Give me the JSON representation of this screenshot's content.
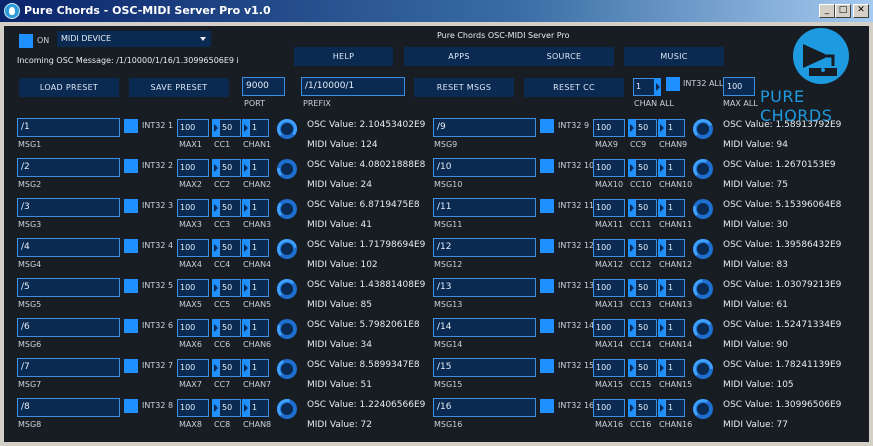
{
  "window": {
    "title": "Pure Chords - OSC-MIDI Server Pro v1.0",
    "minimize_glyph": "_",
    "maximize_glyph": "□",
    "close_glyph": "✕"
  },
  "header": {
    "on_label": "ON",
    "device_selected": "MIDI DEVICE",
    "app_title": "Pure Chords OSC-MIDI Server Pro",
    "incoming_label": "Incoming OSC Message: /1/10000/1/16/1.30996506E9 i",
    "nav_buttons": [
      "HELP",
      "APPS",
      "SOURCE",
      "MUSIC"
    ],
    "load_preset": "LOAD PRESET",
    "save_preset": "SAVE PRESET",
    "port_value": "9000",
    "port_label": "PORT",
    "prefix_value": "/1/10000/1",
    "prefix_label": "PREFIX",
    "reset_msgs": "RESET MSGS",
    "reset_cc": "RESET CC",
    "chan_all_value": "1",
    "chan_all_label": "CHAN ALL",
    "int32_all_label": "INT32 ALL",
    "max_all_value": "100",
    "max_all_label": "MAX ALL"
  },
  "logo": {
    "text": "PURE CHORDS",
    "icon": "gramophone-icon",
    "color": "#1e9be0"
  },
  "accent_color": "#1e90ff",
  "channels": [
    {
      "msg": "/1",
      "msg_label": "MSG1",
      "int32": "INT32 1",
      "max": "100",
      "max_label": "MAX1",
      "cc": "50",
      "cc_label": "CC1",
      "chan": "1",
      "chan_label": "CHAN1",
      "osc": "OSC Value: 2.10453402E9",
      "midi": "MIDI Value: 124",
      "knob": 0.98
    },
    {
      "msg": "/2",
      "msg_label": "MSG2",
      "int32": "INT32 2",
      "max": "100",
      "max_label": "MAX2",
      "cc": "50",
      "cc_label": "CC2",
      "chan": "1",
      "chan_label": "CHAN2",
      "osc": "OSC Value: 4.08021888E8",
      "midi": "MIDI Value: 24",
      "knob": 0.19
    },
    {
      "msg": "/3",
      "msg_label": "MSG3",
      "int32": "INT32 3",
      "max": "100",
      "max_label": "MAX3",
      "cc": "50",
      "cc_label": "CC3",
      "chan": "1",
      "chan_label": "CHAN3",
      "osc": "OSC Value: 6.8719475E8",
      "midi": "MIDI Value: 41",
      "knob": 0.32
    },
    {
      "msg": "/4",
      "msg_label": "MSG4",
      "int32": "INT32 4",
      "max": "100",
      "max_label": "MAX4",
      "cc": "50",
      "cc_label": "CC4",
      "chan": "1",
      "chan_label": "CHAN4",
      "osc": "OSC Value: 1.71798694E9",
      "midi": "MIDI Value: 102",
      "knob": 0.8
    },
    {
      "msg": "/5",
      "msg_label": "MSG5",
      "int32": "INT32 5",
      "max": "100",
      "max_label": "MAX5",
      "cc": "50",
      "cc_label": "CC5",
      "chan": "1",
      "chan_label": "CHAN5",
      "osc": "OSC Value: 1.43881408E9",
      "midi": "MIDI Value: 85",
      "knob": 0.67
    },
    {
      "msg": "/6",
      "msg_label": "MSG6",
      "int32": "INT32 6",
      "max": "100",
      "max_label": "MAX6",
      "cc": "50",
      "cc_label": "CC6",
      "chan": "1",
      "chan_label": "CHAN6",
      "osc": "OSC Value: 5.7982061E8",
      "midi": "MIDI Value: 34",
      "knob": 0.27
    },
    {
      "msg": "/7",
      "msg_label": "MSG7",
      "int32": "INT32 7",
      "max": "100",
      "max_label": "MAX7",
      "cc": "50",
      "cc_label": "CC7",
      "chan": "1",
      "chan_label": "CHAN7",
      "osc": "OSC Value: 8.5899347E8",
      "midi": "MIDI Value: 51",
      "knob": 0.4
    },
    {
      "msg": "/8",
      "msg_label": "MSG8",
      "int32": "INT32 8",
      "max": "100",
      "max_label": "MAX8",
      "cc": "50",
      "cc_label": "CC8",
      "chan": "1",
      "chan_label": "CHAN8",
      "osc": "OSC Value: 1.22406566E9",
      "midi": "MIDI Value: 72",
      "knob": 0.57
    },
    {
      "msg": "/9",
      "msg_label": "MSG9",
      "int32": "INT32 9",
      "max": "100",
      "max_label": "MAX9",
      "cc": "50",
      "cc_label": "CC9",
      "chan": "1",
      "chan_label": "CHAN9",
      "osc": "OSC Value: 1.58913792E9",
      "midi": "MIDI Value: 94",
      "knob": 0.74
    },
    {
      "msg": "/10",
      "msg_label": "MSG10",
      "int32": "INT32 10",
      "max": "100",
      "max_label": "MAX10",
      "cc": "50",
      "cc_label": "CC10",
      "chan": "1",
      "chan_label": "CHAN10",
      "osc": "OSC Value: 1.2670153E9",
      "midi": "MIDI Value: 75",
      "knob": 0.59
    },
    {
      "msg": "/11",
      "msg_label": "MSG11",
      "int32": "INT32 11",
      "max": "100",
      "max_label": "MAX11",
      "cc": "50",
      "cc_label": "CC11",
      "chan": "1",
      "chan_label": "CHAN11",
      "osc": "OSC Value: 5.15396064E8",
      "midi": "MIDI Value: 30",
      "knob": 0.24
    },
    {
      "msg": "/12",
      "msg_label": "MSG12",
      "int32": "INT32 12",
      "max": "100",
      "max_label": "MAX12",
      "cc": "50",
      "cc_label": "CC12",
      "chan": "1",
      "chan_label": "CHAN12",
      "osc": "OSC Value: 1.39586432E9",
      "midi": "MIDI Value: 83",
      "knob": 0.65
    },
    {
      "msg": "/13",
      "msg_label": "MSG13",
      "int32": "INT32 13",
      "max": "100",
      "max_label": "MAX13",
      "cc": "50",
      "cc_label": "CC13",
      "chan": "1",
      "chan_label": "CHAN13",
      "osc": "OSC Value: 1.03079213E9",
      "midi": "MIDI Value: 61",
      "knob": 0.48
    },
    {
      "msg": "/14",
      "msg_label": "MSG14",
      "int32": "INT32 14",
      "max": "100",
      "max_label": "MAX14",
      "cc": "50",
      "cc_label": "CC14",
      "chan": "1",
      "chan_label": "CHAN14",
      "osc": "OSC Value: 1.52471334E9",
      "midi": "MIDI Value: 90",
      "knob": 0.71
    },
    {
      "msg": "/15",
      "msg_label": "MSG15",
      "int32": "INT32 15",
      "max": "100",
      "max_label": "MAX15",
      "cc": "50",
      "cc_label": "CC15",
      "chan": "1",
      "chan_label": "CHAN15",
      "osc": "OSC Value: 1.78241139E9",
      "midi": "MIDI Value: 105",
      "knob": 0.83
    },
    {
      "msg": "/16",
      "msg_label": "MSG16",
      "int32": "INT32 16",
      "max": "100",
      "max_label": "MAX16",
      "cc": "50",
      "cc_label": "CC16",
      "chan": "1",
      "chan_label": "CHAN16",
      "osc": "OSC Value: 1.30996506E9",
      "midi": "MIDI Value: 77",
      "knob": 0.61
    }
  ]
}
